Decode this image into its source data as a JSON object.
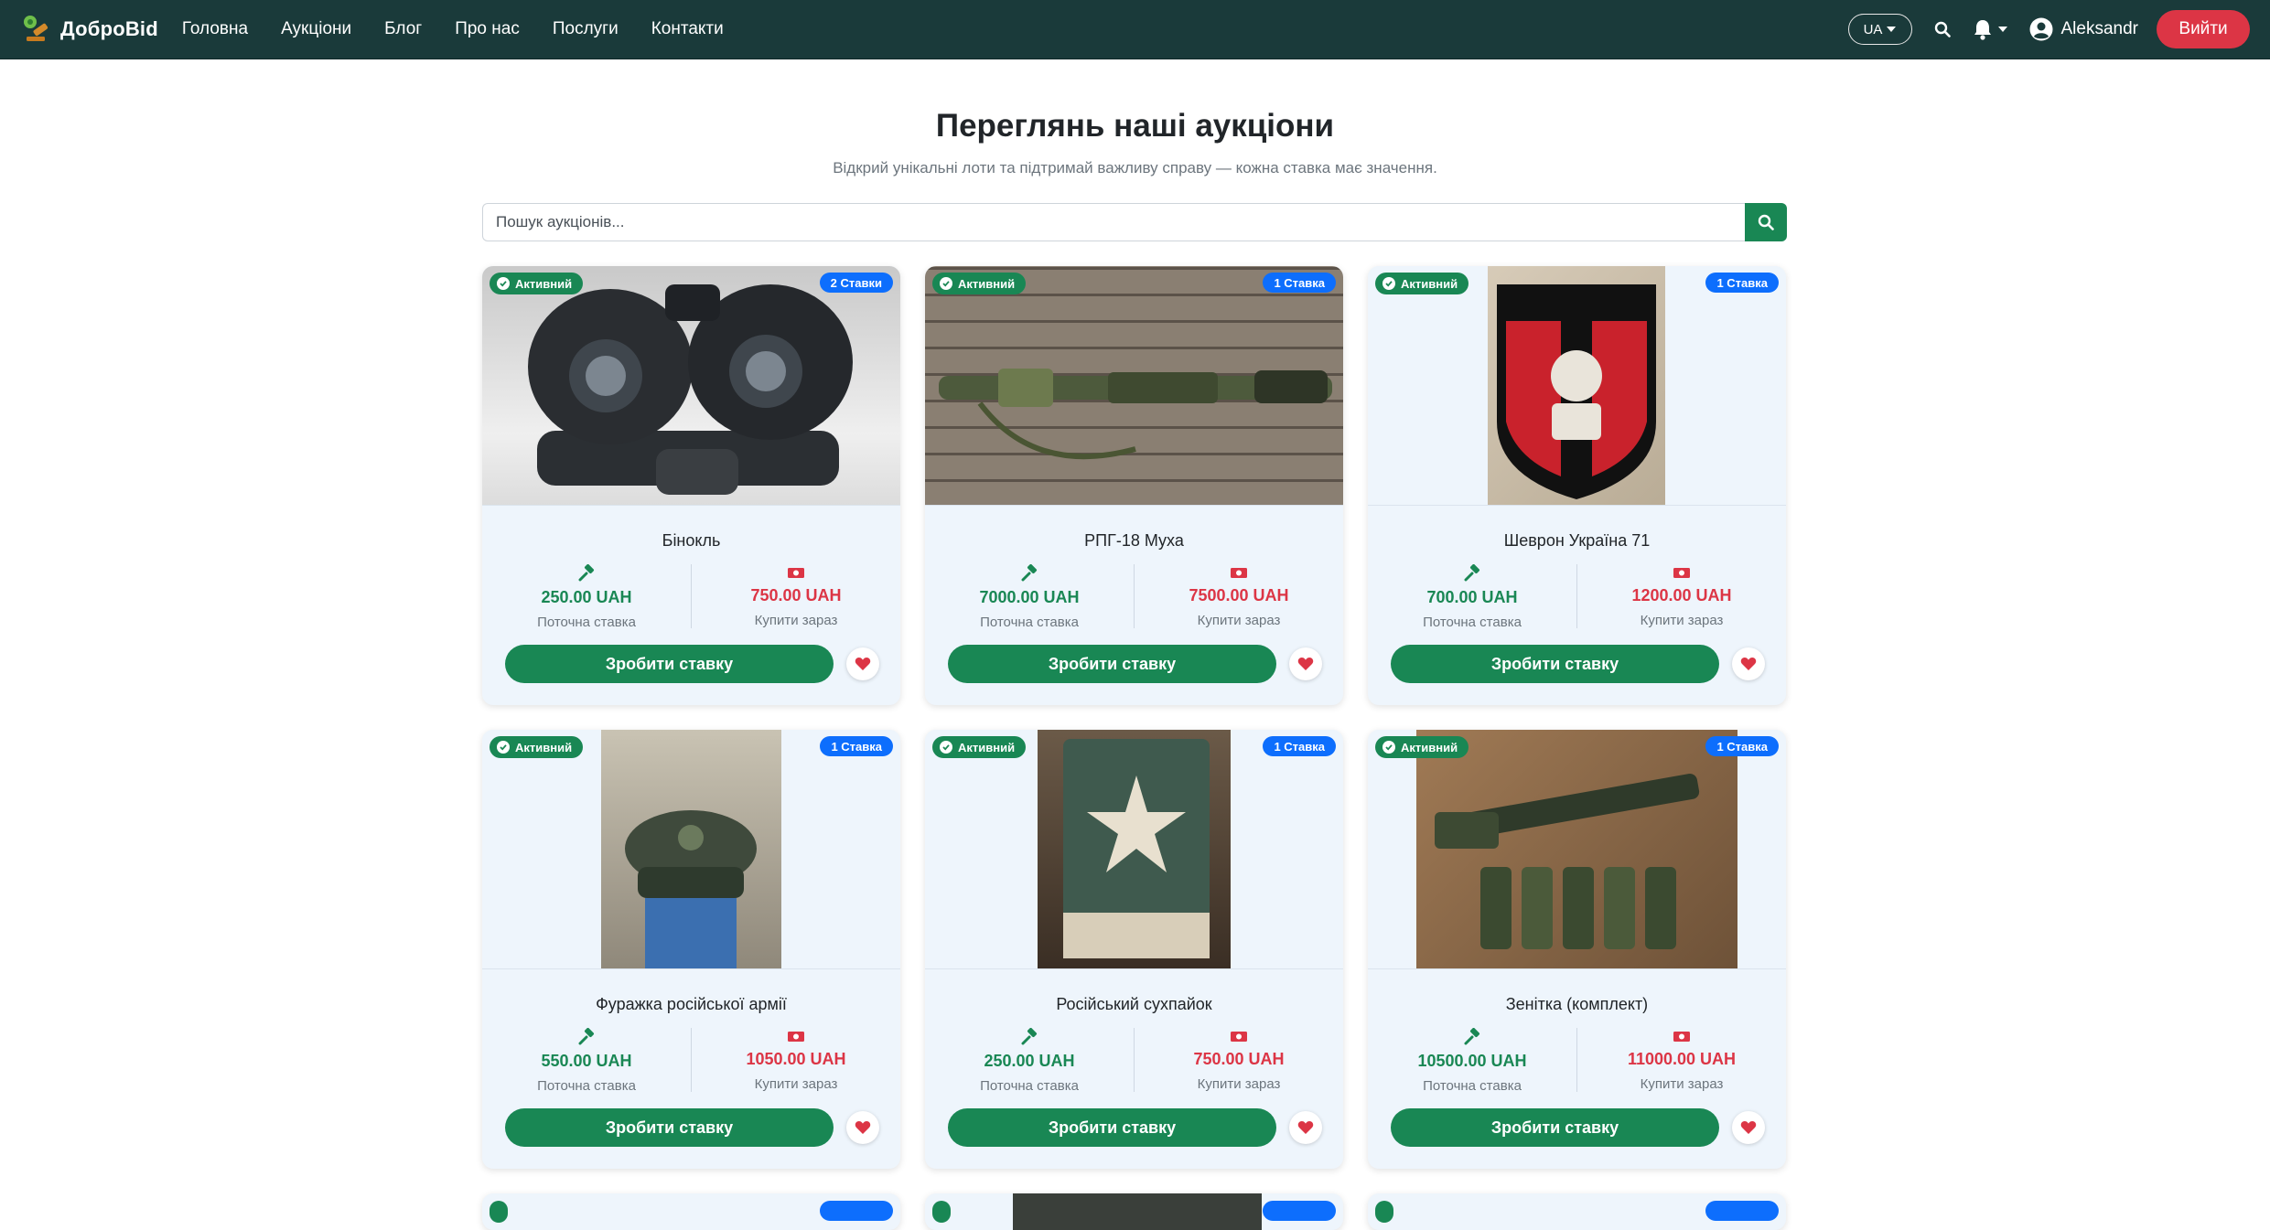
{
  "nav": {
    "brand": "ДоброBid",
    "links": [
      "Головна",
      "Аукціони",
      "Блог",
      "Про нас",
      "Послуги",
      "Контакти"
    ],
    "lang": "UA",
    "user": "Aleksandr",
    "logout": "Вийти"
  },
  "header": {
    "title": "Переглянь наші аукціони",
    "subtitle": "Відкрий унікальні лоти та підтримай важливу справу — кожна ставка має значення."
  },
  "search": {
    "placeholder": "Пошук аукціонів..."
  },
  "colors": {
    "navbar": "#1a3a3a",
    "primary": "#198754",
    "danger": "#dc3545",
    "info": "#0d6efd",
    "card_bg": "#eef5fc"
  },
  "labels": {
    "current_bid": "Поточна ставка",
    "buy_now": "Купити зараз",
    "place_bid": "Зробити ставку"
  },
  "cards": [
    {
      "status": "Активний",
      "bids": "2 Ставки",
      "title": "Бінокль",
      "current": "250.00 UAH",
      "buynow": "750.00 UAH"
    },
    {
      "status": "Активний",
      "bids": "1 Ставка",
      "title": "РПГ-18 Муха",
      "current": "7000.00 UAH",
      "buynow": "7500.00 UAH"
    },
    {
      "status": "Активний",
      "bids": "1 Ставка",
      "title": "Шеврон Україна 71",
      "current": "700.00 UAH",
      "buynow": "1200.00 UAH"
    },
    {
      "status": "Активний",
      "bids": "1 Ставка",
      "title": "Фуражка російської армії",
      "current": "550.00 UAH",
      "buynow": "1050.00 UAH"
    },
    {
      "status": "Активний",
      "bids": "1 Ставка",
      "title": "Російський сухпайок",
      "current": "250.00 UAH",
      "buynow": "750.00 UAH"
    },
    {
      "status": "Активний",
      "bids": "1 Ставка",
      "title": "Зенітка (комплект)",
      "current": "10500.00 UAH",
      "buynow": "11000.00 UAH"
    }
  ]
}
